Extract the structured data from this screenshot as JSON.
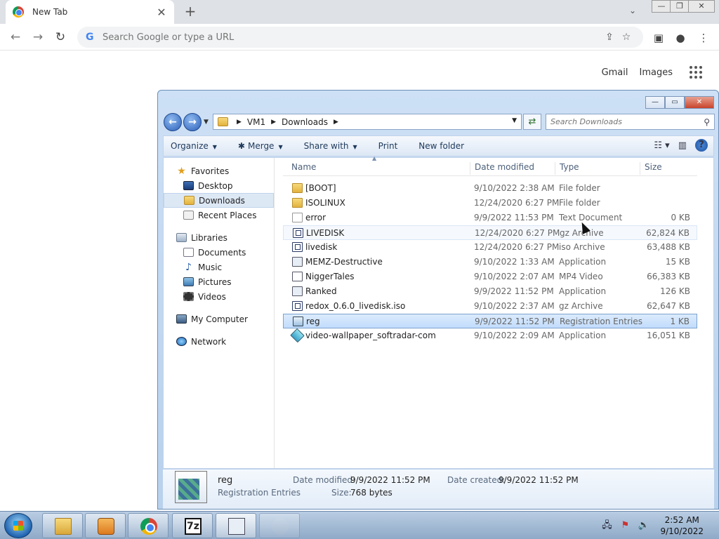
{
  "browser": {
    "tab_title": "New Tab",
    "tab_close": "✕",
    "new_tab": "+",
    "omnibox_placeholder": "Search Google or type a URL",
    "ntp_links": [
      "Gmail",
      "Images"
    ],
    "window_controls": [
      "—",
      "❐",
      "✕"
    ],
    "icons": [
      "back-icon",
      "forward-icon",
      "reload-icon",
      "share-icon",
      "star-icon",
      "sidepanel-icon",
      "profile-icon",
      "menu-icon",
      "apps-grid-icon"
    ]
  },
  "explorer": {
    "caption_buttons": [
      "—",
      "▭",
      "✕"
    ],
    "breadcrumb": [
      "VM1",
      "Downloads"
    ],
    "search_placeholder": "Search Downloads",
    "commands": [
      "Organize",
      "Merge",
      "Share with",
      "Print",
      "New folder"
    ],
    "sidebar": {
      "favorites": {
        "label": "Favorites",
        "items": [
          "Desktop",
          "Downloads",
          "Recent Places"
        ]
      },
      "libraries": {
        "label": "Libraries",
        "items": [
          "Documents",
          "Music",
          "Pictures",
          "Videos"
        ]
      },
      "computer": "My Computer",
      "network": "Network"
    },
    "columns": {
      "name": "Name",
      "date": "Date modified",
      "type": "Type",
      "size": "Size"
    },
    "files": [
      {
        "name": "[BOOT]",
        "date": "9/10/2022 2:38 AM",
        "type": "File folder",
        "size": "",
        "icon": "folder"
      },
      {
        "name": "ISOLINUX",
        "date": "12/24/2020 6:27 PM",
        "type": "File folder",
        "size": "",
        "icon": "folder"
      },
      {
        "name": "error",
        "date": "9/9/2022 11:53 PM",
        "type": "Text Document",
        "size": "0 KB",
        "icon": "text"
      },
      {
        "name": "LIVEDISK",
        "date": "12/24/2020 6:27 PM",
        "type": "gz Archive",
        "size": "62,824 KB",
        "icon": "archive"
      },
      {
        "name": "livedisk",
        "date": "12/24/2020 6:27 PM",
        "type": "iso Archive",
        "size": "63,488 KB",
        "icon": "archive"
      },
      {
        "name": "MEMZ-Destructive",
        "date": "9/10/2022 1:33 AM",
        "type": "Application",
        "size": "15 KB",
        "icon": "app"
      },
      {
        "name": "NiggerTales",
        "date": "9/10/2022 2:07 AM",
        "type": "MP4 Video",
        "size": "66,383 KB",
        "icon": "video"
      },
      {
        "name": "Ranked",
        "date": "9/9/2022 11:52 PM",
        "type": "Application",
        "size": "126 KB",
        "icon": "app"
      },
      {
        "name": "redox_0.6.0_livedisk.iso",
        "date": "9/10/2022 2:37 AM",
        "type": "gz Archive",
        "size": "62,647 KB",
        "icon": "archive"
      },
      {
        "name": "reg",
        "date": "9/9/2022 11:52 PM",
        "type": "Registration Entries",
        "size": "1 KB",
        "icon": "reg"
      },
      {
        "name": "video-wallpaper_softradar-com",
        "date": "9/10/2022 2:09 AM",
        "type": "Application",
        "size": "16,051 KB",
        "icon": "setup"
      }
    ],
    "selected_index": 9,
    "hover_index": 3,
    "details": {
      "name": "reg",
      "type": "Registration Entries",
      "modified_label": "Date modified:",
      "modified": "9/9/2022 11:52 PM",
      "created_label": "Date created:",
      "created": "9/9/2022 11:52 PM",
      "size_label": "Size:",
      "size": "768 bytes"
    }
  },
  "taskbar": {
    "apps": [
      "explorer-icon",
      "media-player-icon",
      "chrome-icon",
      "7zip-icon",
      "registry-icon",
      "ghost-icon"
    ],
    "app_7z_label": "7z",
    "clock_time": "2:52 AM",
    "clock_date": "9/10/2022"
  }
}
